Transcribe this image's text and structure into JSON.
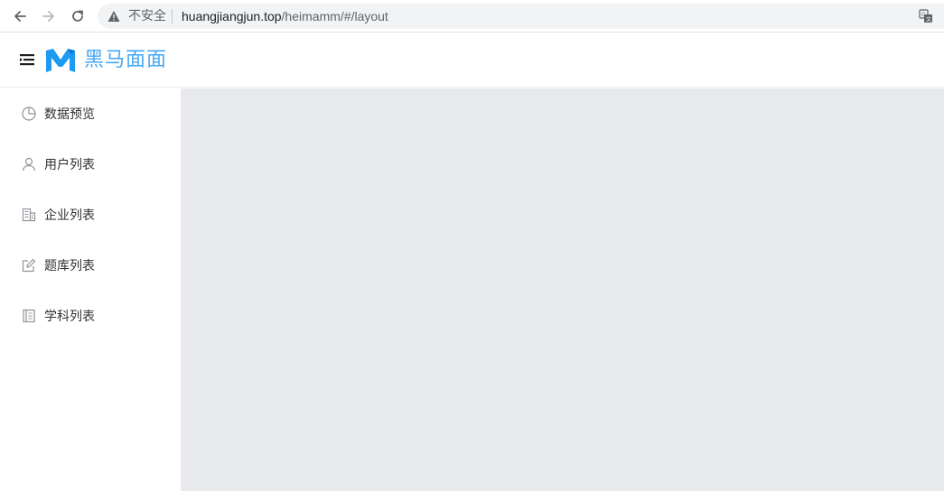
{
  "browser": {
    "security_label": "不安全",
    "url_host": "huangjiangjun.top",
    "url_path": "/heimamm/#/layout",
    "icons": [
      "back-icon",
      "forward-icon",
      "reload-icon",
      "warning-icon",
      "translate-icon"
    ]
  },
  "header": {
    "logo_letter": "M",
    "title": "黑马面面",
    "accent_color": "#46a8f5",
    "icons": [
      "hamburger-icon",
      "logo-icon"
    ]
  },
  "sidebar": {
    "items": [
      {
        "label": "数据预览",
        "icon": "pie-chart-icon"
      },
      {
        "label": "用户列表",
        "icon": "user-icon"
      },
      {
        "label": "企业列表",
        "icon": "office-building-icon"
      },
      {
        "label": "题库列表",
        "icon": "edit-icon"
      },
      {
        "label": "学科列表",
        "icon": "notebook-icon"
      }
    ]
  },
  "main": {
    "background_color": "#e8e9ed"
  }
}
